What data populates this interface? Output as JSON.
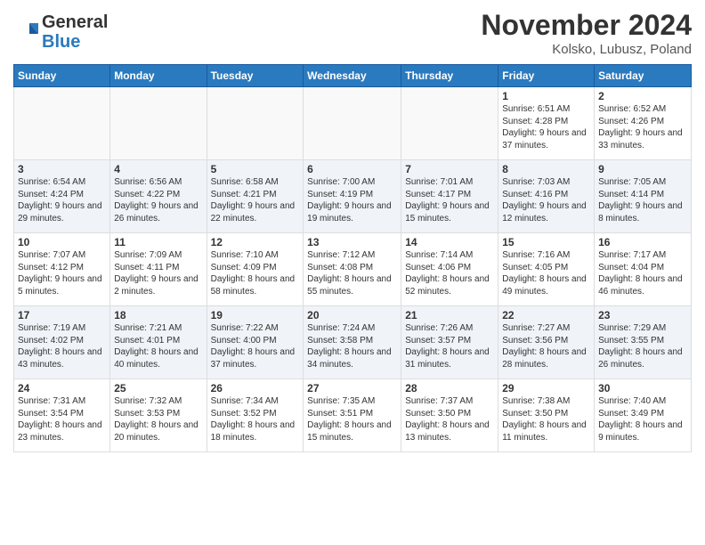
{
  "header": {
    "logo_general": "General",
    "logo_blue": "Blue",
    "month_title": "November 2024",
    "location": "Kolsko, Lubusz, Poland"
  },
  "days_of_week": [
    "Sunday",
    "Monday",
    "Tuesday",
    "Wednesday",
    "Thursday",
    "Friday",
    "Saturday"
  ],
  "weeks": [
    [
      {
        "day": "",
        "info": ""
      },
      {
        "day": "",
        "info": ""
      },
      {
        "day": "",
        "info": ""
      },
      {
        "day": "",
        "info": ""
      },
      {
        "day": "",
        "info": ""
      },
      {
        "day": "1",
        "info": "Sunrise: 6:51 AM\nSunset: 4:28 PM\nDaylight: 9 hours\nand 37 minutes."
      },
      {
        "day": "2",
        "info": "Sunrise: 6:52 AM\nSunset: 4:26 PM\nDaylight: 9 hours\nand 33 minutes."
      }
    ],
    [
      {
        "day": "3",
        "info": "Sunrise: 6:54 AM\nSunset: 4:24 PM\nDaylight: 9 hours\nand 29 minutes."
      },
      {
        "day": "4",
        "info": "Sunrise: 6:56 AM\nSunset: 4:22 PM\nDaylight: 9 hours\nand 26 minutes."
      },
      {
        "day": "5",
        "info": "Sunrise: 6:58 AM\nSunset: 4:21 PM\nDaylight: 9 hours\nand 22 minutes."
      },
      {
        "day": "6",
        "info": "Sunrise: 7:00 AM\nSunset: 4:19 PM\nDaylight: 9 hours\nand 19 minutes."
      },
      {
        "day": "7",
        "info": "Sunrise: 7:01 AM\nSunset: 4:17 PM\nDaylight: 9 hours\nand 15 minutes."
      },
      {
        "day": "8",
        "info": "Sunrise: 7:03 AM\nSunset: 4:16 PM\nDaylight: 9 hours\nand 12 minutes."
      },
      {
        "day": "9",
        "info": "Sunrise: 7:05 AM\nSunset: 4:14 PM\nDaylight: 9 hours\nand 8 minutes."
      }
    ],
    [
      {
        "day": "10",
        "info": "Sunrise: 7:07 AM\nSunset: 4:12 PM\nDaylight: 9 hours\nand 5 minutes."
      },
      {
        "day": "11",
        "info": "Sunrise: 7:09 AM\nSunset: 4:11 PM\nDaylight: 9 hours\nand 2 minutes."
      },
      {
        "day": "12",
        "info": "Sunrise: 7:10 AM\nSunset: 4:09 PM\nDaylight: 8 hours\nand 58 minutes."
      },
      {
        "day": "13",
        "info": "Sunrise: 7:12 AM\nSunset: 4:08 PM\nDaylight: 8 hours\nand 55 minutes."
      },
      {
        "day": "14",
        "info": "Sunrise: 7:14 AM\nSunset: 4:06 PM\nDaylight: 8 hours\nand 52 minutes."
      },
      {
        "day": "15",
        "info": "Sunrise: 7:16 AM\nSunset: 4:05 PM\nDaylight: 8 hours\nand 49 minutes."
      },
      {
        "day": "16",
        "info": "Sunrise: 7:17 AM\nSunset: 4:04 PM\nDaylight: 8 hours\nand 46 minutes."
      }
    ],
    [
      {
        "day": "17",
        "info": "Sunrise: 7:19 AM\nSunset: 4:02 PM\nDaylight: 8 hours\nand 43 minutes."
      },
      {
        "day": "18",
        "info": "Sunrise: 7:21 AM\nSunset: 4:01 PM\nDaylight: 8 hours\nand 40 minutes."
      },
      {
        "day": "19",
        "info": "Sunrise: 7:22 AM\nSunset: 4:00 PM\nDaylight: 8 hours\nand 37 minutes."
      },
      {
        "day": "20",
        "info": "Sunrise: 7:24 AM\nSunset: 3:58 PM\nDaylight: 8 hours\nand 34 minutes."
      },
      {
        "day": "21",
        "info": "Sunrise: 7:26 AM\nSunset: 3:57 PM\nDaylight: 8 hours\nand 31 minutes."
      },
      {
        "day": "22",
        "info": "Sunrise: 7:27 AM\nSunset: 3:56 PM\nDaylight: 8 hours\nand 28 minutes."
      },
      {
        "day": "23",
        "info": "Sunrise: 7:29 AM\nSunset: 3:55 PM\nDaylight: 8 hours\nand 26 minutes."
      }
    ],
    [
      {
        "day": "24",
        "info": "Sunrise: 7:31 AM\nSunset: 3:54 PM\nDaylight: 8 hours\nand 23 minutes."
      },
      {
        "day": "25",
        "info": "Sunrise: 7:32 AM\nSunset: 3:53 PM\nDaylight: 8 hours\nand 20 minutes."
      },
      {
        "day": "26",
        "info": "Sunrise: 7:34 AM\nSunset: 3:52 PM\nDaylight: 8 hours\nand 18 minutes."
      },
      {
        "day": "27",
        "info": "Sunrise: 7:35 AM\nSunset: 3:51 PM\nDaylight: 8 hours\nand 15 minutes."
      },
      {
        "day": "28",
        "info": "Sunrise: 7:37 AM\nSunset: 3:50 PM\nDaylight: 8 hours\nand 13 minutes."
      },
      {
        "day": "29",
        "info": "Sunrise: 7:38 AM\nSunset: 3:50 PM\nDaylight: 8 hours\nand 11 minutes."
      },
      {
        "day": "30",
        "info": "Sunrise: 7:40 AM\nSunset: 3:49 PM\nDaylight: 8 hours\nand 9 minutes."
      }
    ]
  ]
}
